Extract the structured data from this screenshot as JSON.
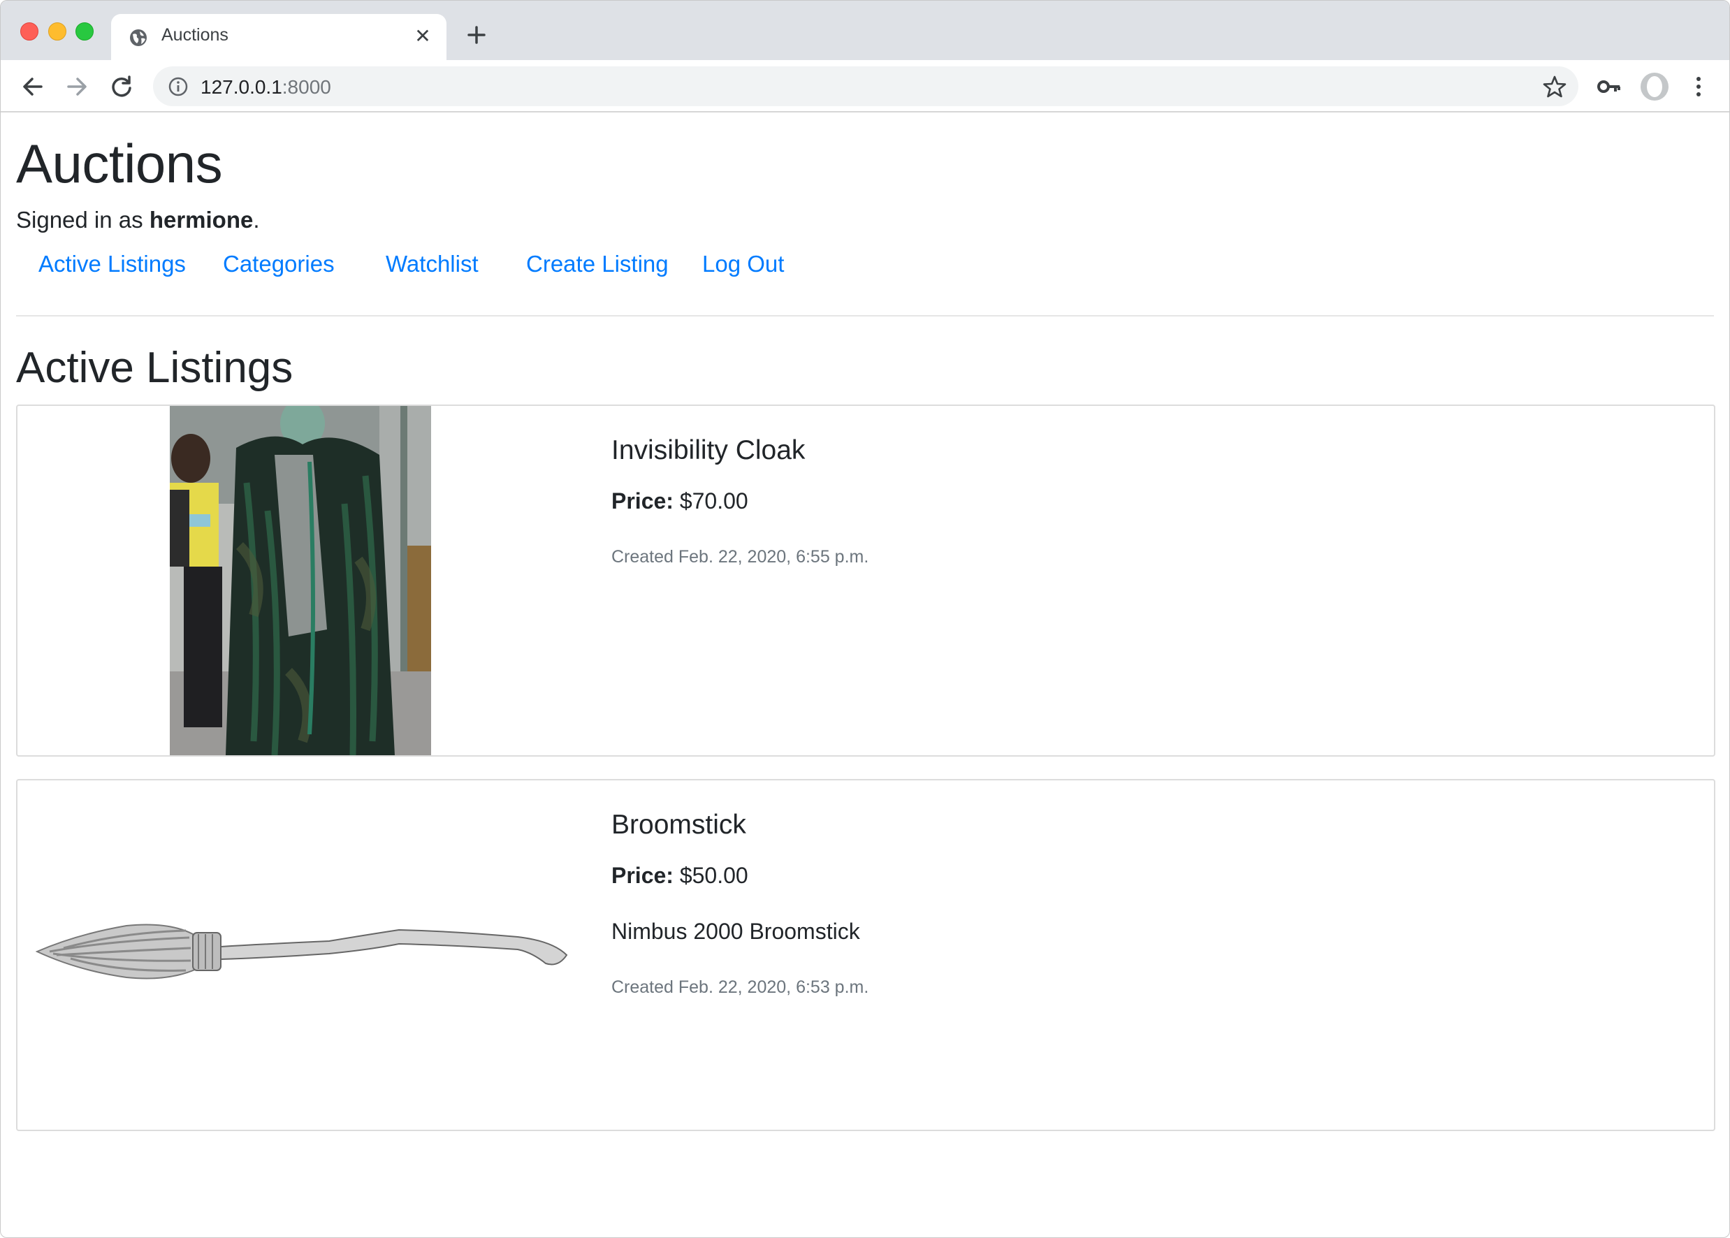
{
  "browser": {
    "tab_title": "Auctions",
    "url_host": "127.0.0.1",
    "url_port": ":8000"
  },
  "page": {
    "site_title": "Auctions",
    "signed_in_prefix": "Signed in as ",
    "username": "hermione",
    "signed_in_suffix": ".",
    "nav": {
      "active_listings": "Active Listings",
      "categories": "Categories",
      "watchlist": "Watchlist",
      "create_listing": "Create Listing",
      "log_out": "Log Out"
    },
    "section_title": "Active Listings",
    "listings": [
      {
        "title": "Invisibility Cloak",
        "price_label": "Price:",
        "price": "$70.00",
        "description": "",
        "created": "Created Feb. 22, 2020, 6:55 p.m."
      },
      {
        "title": "Broomstick",
        "price_label": "Price:",
        "price": "$50.00",
        "description": "Nimbus 2000 Broomstick",
        "created": "Created Feb. 22, 2020, 6:53 p.m."
      }
    ]
  },
  "colors": {
    "link": "#007bff",
    "muted": "#6c757d",
    "text": "#212529"
  },
  "icons": [
    "globe-icon",
    "close-icon",
    "plus-icon",
    "back-arrow-icon",
    "forward-arrow-icon",
    "reload-icon",
    "info-icon",
    "star-icon",
    "key-icon",
    "profile-icon",
    "more-vert-icon"
  ]
}
